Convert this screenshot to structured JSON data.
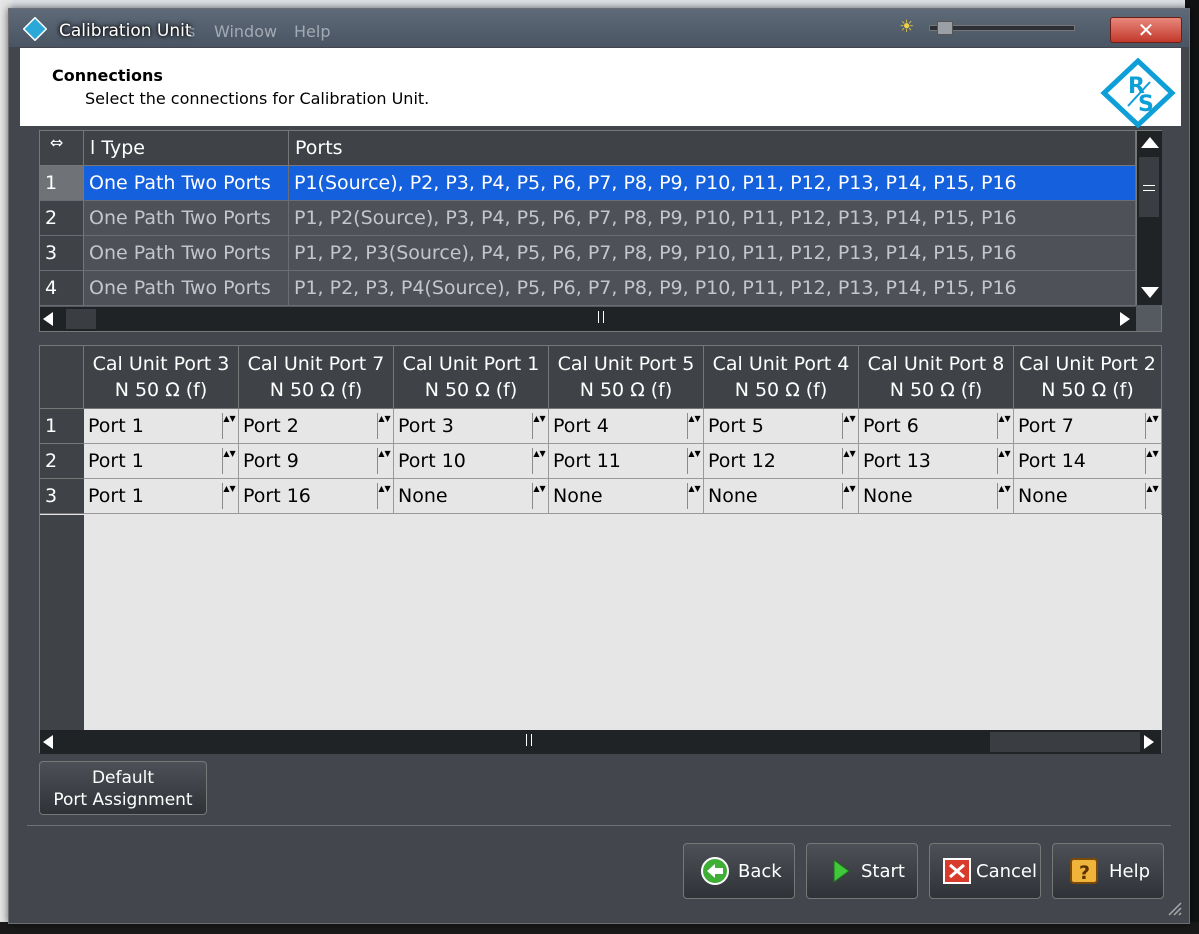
{
  "window": {
    "title": "Calibration Unit",
    "background_menus": [
      "s",
      "Window",
      "Help"
    ]
  },
  "header": {
    "title": "Connections",
    "subtitle": "Select the connections for Calibration Unit."
  },
  "connections_table": {
    "columns": [
      "l Type",
      "Ports"
    ],
    "rows": [
      {
        "index": "1",
        "type": "One Path Two Ports",
        "ports": "P1(Source), P2, P3, P4, P5, P6, P7, P8, P9, P10, P11, P12, P13, P14, P15, P16",
        "selected": true
      },
      {
        "index": "2",
        "type": "One Path Two Ports",
        "ports": "P1, P2(Source), P3, P4, P5, P6, P7, P8, P9, P10, P11, P12, P13, P14, P15, P16",
        "selected": false
      },
      {
        "index": "3",
        "type": "One Path Two Ports",
        "ports": "P1, P2, P3(Source), P4, P5, P6, P7, P8, P9, P10, P11, P12, P13, P14, P15, P16",
        "selected": false
      },
      {
        "index": "4",
        "type": "One Path Two Ports",
        "ports": "P1, P2, P3, P4(Source), P5, P6, P7, P8, P9, P10, P11, P12, P13, P14, P15, P16",
        "selected": false
      }
    ]
  },
  "port_table": {
    "columns": [
      {
        "line1": "Cal Unit Port 3",
        "line2": "N 50 Ω (f)"
      },
      {
        "line1": "Cal Unit Port 7",
        "line2": "N 50 Ω (f)"
      },
      {
        "line1": "Cal Unit Port 1",
        "line2": "N 50 Ω (f)"
      },
      {
        "line1": "Cal Unit Port 5",
        "line2": "N 50 Ω (f)"
      },
      {
        "line1": "Cal Unit Port 4",
        "line2": "N 50 Ω (f)"
      },
      {
        "line1": "Cal Unit Port 8",
        "line2": "N 50 Ω (f)"
      },
      {
        "line1": "Cal Unit Port 2",
        "line2": "N 50 Ω (f)"
      }
    ],
    "rows": [
      {
        "index": "1",
        "values": [
          "Port 1",
          "Port 2",
          "Port 3",
          "Port 4",
          "Port 5",
          "Port 6",
          "Port 7"
        ]
      },
      {
        "index": "2",
        "values": [
          "Port 1",
          "Port 9",
          "Port 10",
          "Port 11",
          "Port 12",
          "Port 13",
          "Port 14"
        ]
      },
      {
        "index": "3",
        "values": [
          "Port 1",
          "Port 16",
          "None",
          "None",
          "None",
          "None",
          "None"
        ]
      }
    ]
  },
  "buttons": {
    "default_line1": "Default",
    "default_line2": "Port Assignment",
    "back": "Back",
    "start": "Start",
    "cancel": "Cancel",
    "help": "Help"
  },
  "colors": {
    "selection": "#1560dc",
    "dialog_bg": "#43474d",
    "close_button": "#c2392b"
  }
}
